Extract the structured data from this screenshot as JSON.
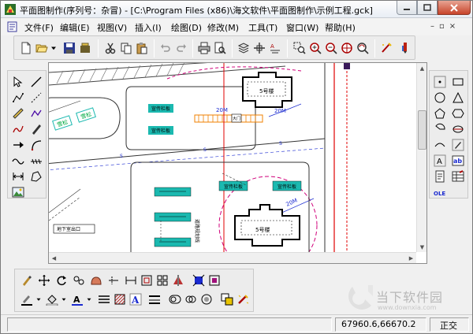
{
  "window": {
    "title": "平面图制作(序列号：杂冒) - [C:\\Program Files (x86)\\海文软件\\平面图制作\\示例工程.gck]"
  },
  "menu": {
    "items": [
      "文件(F)",
      "编辑(E)",
      "视图(V)",
      "插入(I)",
      "绘图(D)",
      "修改(M)",
      "工具(T)",
      "窗口(W)",
      "帮助(H)"
    ],
    "mdi_controls": [
      "–",
      "▫",
      "×"
    ]
  },
  "toolbar": {
    "icons": [
      "new-icon",
      "open-icon",
      "dropdown-arrow-icon",
      "save-icon",
      "save-all-icon",
      "cut-icon",
      "copy-icon",
      "paste-icon",
      "undo-icon",
      "redo-icon",
      "print-icon",
      "print-preview-icon",
      "layer-icon",
      "snap-icon",
      "text-style-icon",
      "zoom-window-icon",
      "zoom-in-icon",
      "zoom-out-icon",
      "crosshair-icon",
      "zoom-extent-icon",
      "magic-tool-icon",
      "pen-tool-icon"
    ]
  },
  "drawing": {
    "labels": {
      "building_top": "5号楼",
      "building_bottom": "5号楼",
      "board_1": "宣传栏板",
      "board_2": "宣传栏板",
      "board_3": "宣传栏板",
      "board_4": "宣传栏板",
      "park_1": "雪松",
      "park_2": "雪松",
      "dim_1": "20M",
      "dim_2": "20M",
      "dim_3": "20M",
      "underground": "地下室出口",
      "road_mark": "道路规划线",
      "small_label": "大门",
      "s_mark_1": "S",
      "s_mark_2": "S",
      "s_mark_3": "S"
    },
    "colors": {
      "road": "#333333",
      "axis_red": "#e00000",
      "circle_magenta": "#d0007a",
      "board_teal": "#1bb9b0",
      "blue_line": "#1a2ad0",
      "hatch_orange": "#f08000"
    }
  },
  "bottom_toolbar": {
    "row1_icons": [
      "brush-icon",
      "move-icon",
      "rotate-icon",
      "mirror-icon",
      "group-icon",
      "cut-line-icon",
      "dimension-icon",
      "select-frame-icon",
      "grid-icon",
      "align-icon",
      "fill-color-icon",
      "node-edit-icon"
    ],
    "row2_icons": [
      "line-color-icon",
      "fill-bucket-icon",
      "font-color-icon",
      "line-style-icon",
      "hatch-icon",
      "text-bold-icon",
      "line-weight-icon",
      "circle-frame-icon",
      "double-circle-icon",
      "circle-dot-icon",
      "bring-front-icon",
      "effect-icon"
    ]
  },
  "status": {
    "coords": "67960.6,66670.2",
    "mode": "正交"
  },
  "watermark": {
    "text": "当下软件园",
    "url": "www.downxia.com"
  }
}
